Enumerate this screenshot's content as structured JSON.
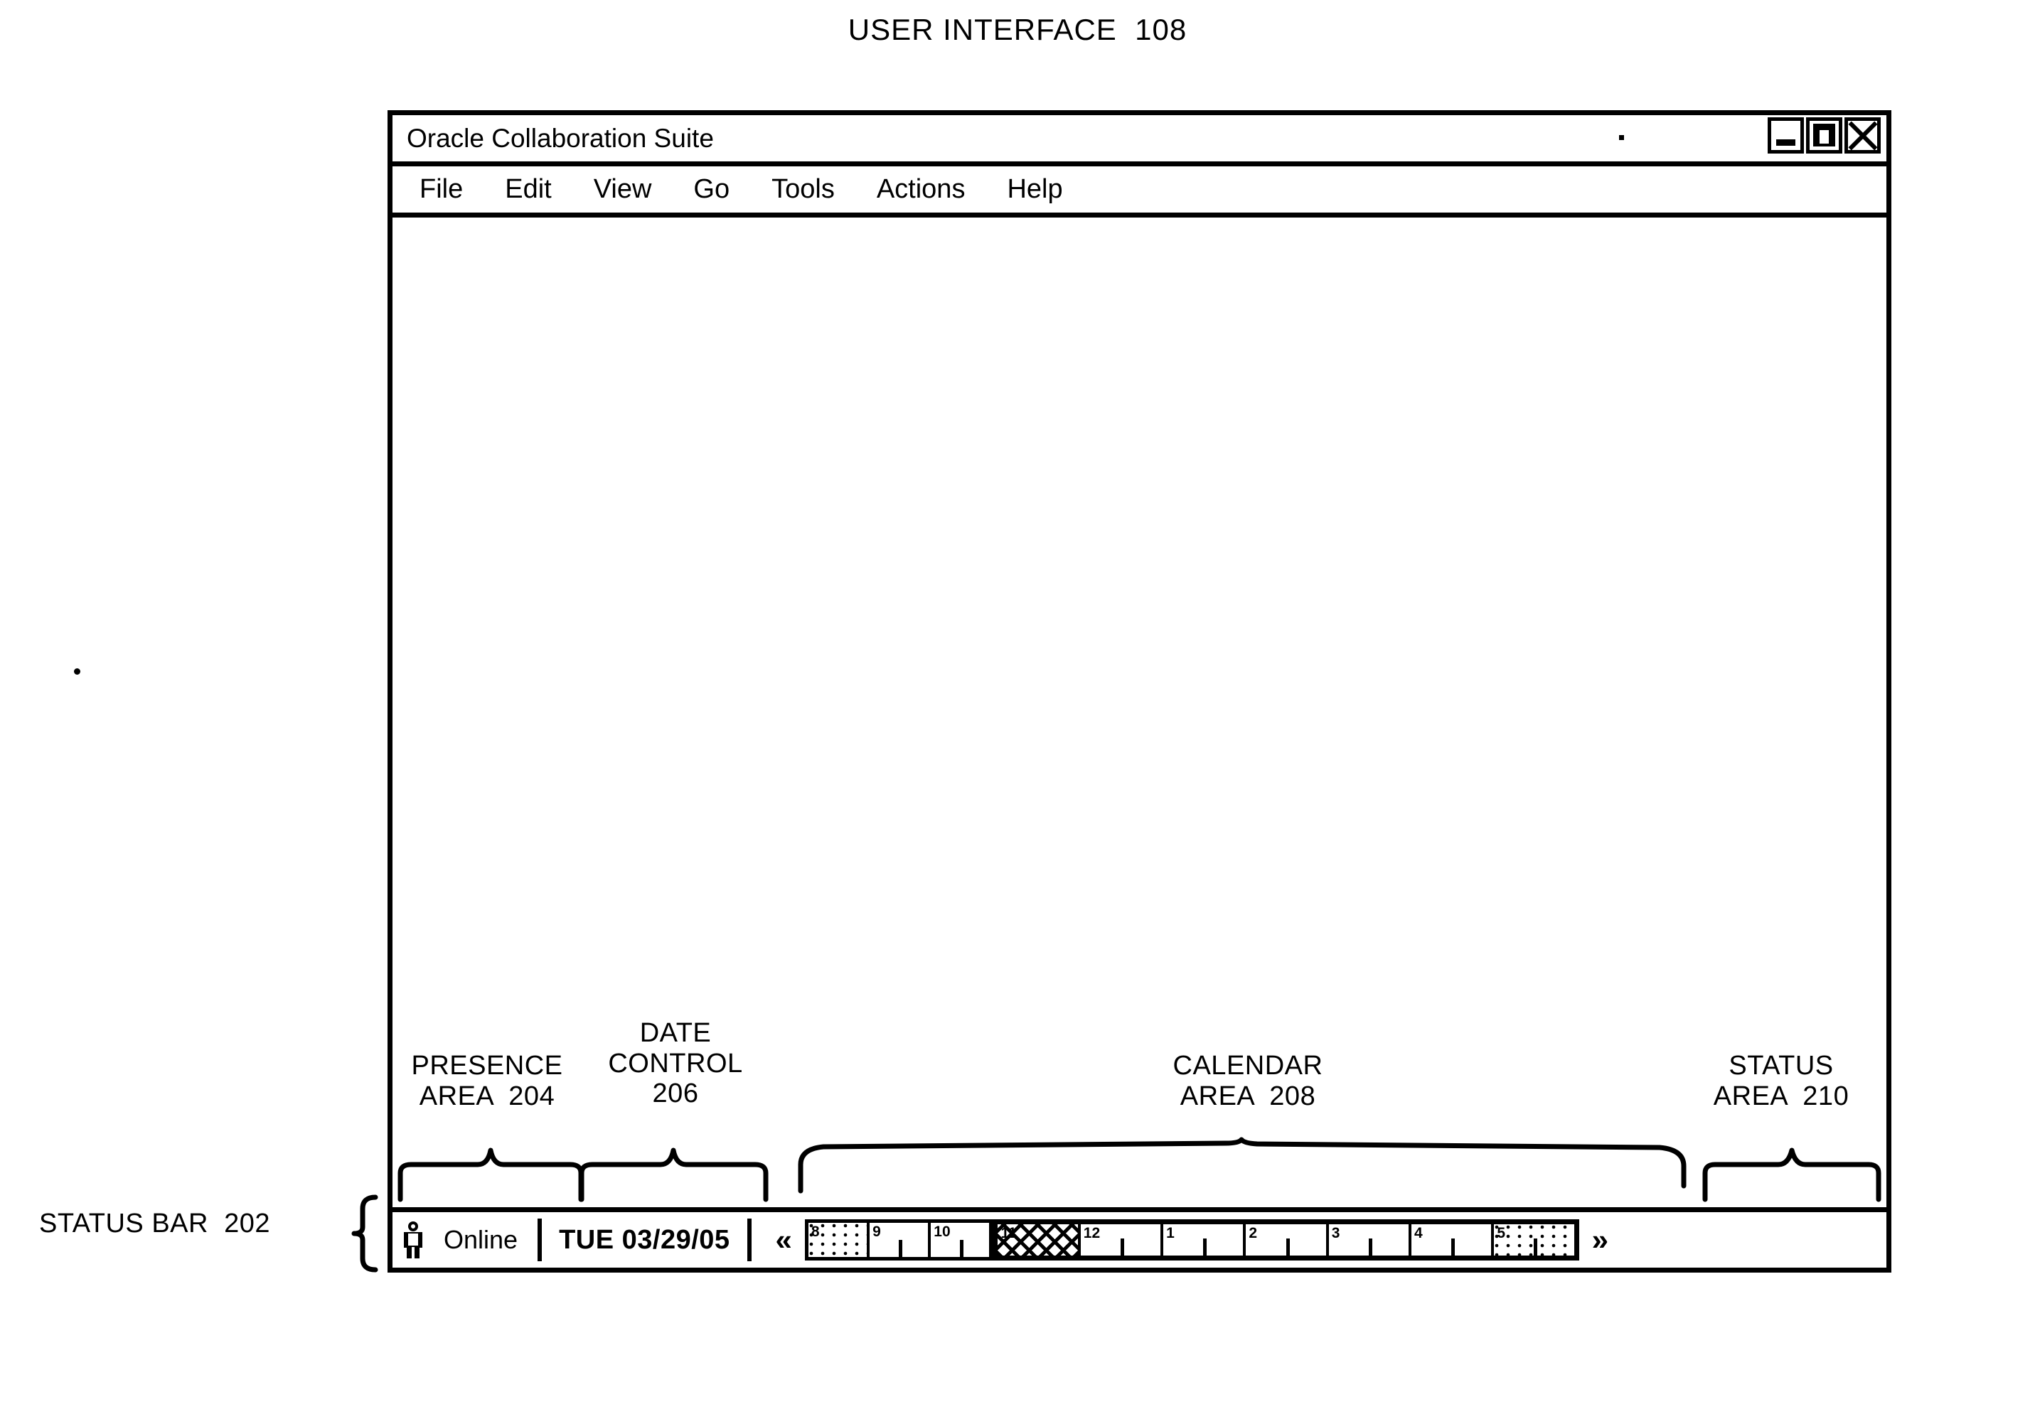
{
  "figure": {
    "title": "USER INTERFACE  108"
  },
  "window": {
    "title": "Oracle Collaboration Suite",
    "controls": [
      {
        "name": "minimize",
        "icon": "minimize-icon"
      },
      {
        "name": "maximize",
        "icon": "maximize-icon"
      },
      {
        "name": "close",
        "icon": "close-icon"
      }
    ]
  },
  "menu": {
    "items": [
      "File",
      "Edit",
      "View",
      "Go",
      "Tools",
      "Actions",
      "Help"
    ]
  },
  "status_bar": {
    "presence": {
      "icon": "person-icon",
      "label": "Online"
    },
    "date_control": {
      "label": "TUE 03/29/05"
    },
    "calendar": {
      "prev_label": "«",
      "next_label": "»",
      "timeline": {
        "past_group": [
          {
            "hour": "8",
            "fill": "dot",
            "tick": false
          },
          {
            "hour": "9",
            "fill": "none",
            "tick": true
          },
          {
            "hour": "10",
            "fill": "none",
            "tick": true
          }
        ],
        "work_group": [
          {
            "hour": "11",
            "fill": "hatch",
            "tick": false
          },
          {
            "hour": "12",
            "fill": "none",
            "tick": true
          },
          {
            "hour": "1",
            "fill": "none",
            "tick": true
          },
          {
            "hour": "2",
            "fill": "none",
            "tick": true
          },
          {
            "hour": "3",
            "fill": "none",
            "tick": true
          },
          {
            "hour": "4",
            "fill": "none",
            "tick": true
          },
          {
            "hour": "5",
            "fill": "dot",
            "tick": true
          }
        ]
      }
    },
    "status": {
      "text": ""
    }
  },
  "callouts": {
    "status_bar": "STATUS BAR  202",
    "presence_area": "PRESENCE\nAREA  204",
    "date_control": "DATE\nCONTROL\n206",
    "calendar_area": "CALENDAR\nAREA  208",
    "status_area": "STATUS\nAREA  210"
  }
}
